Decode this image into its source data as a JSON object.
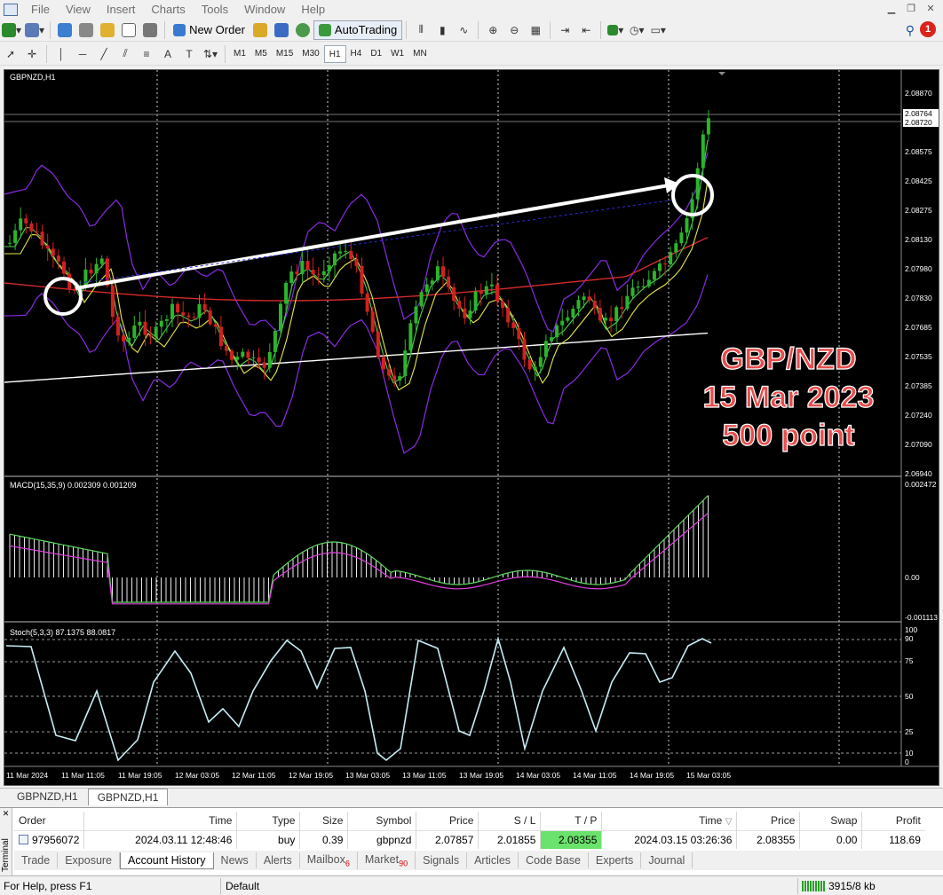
{
  "menu": [
    "File",
    "View",
    "Insert",
    "Charts",
    "Tools",
    "Window",
    "Help"
  ],
  "toolbar": {
    "new_order_label": "New Order",
    "autotrading_label": "AutoTrading",
    "notification_count": "1",
    "timeframes": [
      "M1",
      "M5",
      "M15",
      "M30",
      "H1",
      "H4",
      "D1",
      "W1",
      "MN"
    ],
    "active_timeframe": "H1"
  },
  "chart": {
    "symbol_label": "GBPNZD,H1",
    "annotation": {
      "line1": "GBP/NZD",
      "line2": "15 Mar 2023",
      "line3": "500 point",
      "color": "#e84c4c"
    },
    "price_ticks": [
      "2.08870",
      "2.08720",
      "2.08575",
      "2.08425",
      "2.08275",
      "2.08130",
      "2.07980",
      "2.07830",
      "2.07685",
      "2.07535",
      "2.07385",
      "2.07240",
      "2.07090",
      "2.06940"
    ],
    "current_prices": [
      "2.08764",
      "2.08720"
    ],
    "time_labels": [
      "11 Mar 2024",
      "11 Mar 11:05",
      "11 Mar 19:05",
      "12 Mar 03:05",
      "12 Mar 11:05",
      "12 Mar 19:05",
      "13 Mar 03:05",
      "13 Mar 11:05",
      "13 Mar 19:05",
      "14 Mar 03:05",
      "14 Mar 11:05",
      "14 Mar 19:05",
      "15 Mar 03:05"
    ],
    "macd_label": "MACD(15,35,9) 0.002309 0.001209",
    "macd_ticks": [
      "0.002472",
      "0.00",
      "-0.001113"
    ],
    "stoch_label": "Stoch(5,3,3) 87.1375 88.0817",
    "stoch_ticks": [
      "100",
      "90",
      "75",
      "50",
      "25",
      "10",
      "0"
    ],
    "colors": {
      "bull": "#2bb52b",
      "bear": "#d42020",
      "bb": "#8a2be2",
      "ma_white": "#ffffff",
      "ma_red": "#d42a2a",
      "ma_yellow": "#e8e84a",
      "ma_green": "#4fd04f",
      "stoch": "#c6ecf5"
    }
  },
  "chart_tabs": [
    "GBPNZD,H1",
    "GBPNZD,H1"
  ],
  "terminal": {
    "side_label": "Terminal",
    "columns": [
      "Order",
      "Time",
      "Type",
      "Size",
      "Symbol",
      "Price",
      "S / L",
      "T / P",
      "Time",
      "Price",
      "Swap",
      "Profit"
    ],
    "row": {
      "order": "97956072",
      "time": "2024.03.11 12:48:46",
      "type": "buy",
      "size": "0.39",
      "symbol": "gbpnzd",
      "price": "2.07857",
      "sl": "2.01855",
      "tp": "2.08355",
      "close_time": "2024.03.15 03:26:36",
      "close_price": "2.08355",
      "swap": "0.00",
      "profit": "118.69"
    },
    "tabs": [
      {
        "label": "Trade",
        "badge": ""
      },
      {
        "label": "Exposure",
        "badge": ""
      },
      {
        "label": "Account History",
        "badge": ""
      },
      {
        "label": "News",
        "badge": ""
      },
      {
        "label": "Alerts",
        "badge": ""
      },
      {
        "label": "Mailbox",
        "badge": "6"
      },
      {
        "label": "Market",
        "badge": "90"
      },
      {
        "label": "Signals",
        "badge": ""
      },
      {
        "label": "Articles",
        "badge": ""
      },
      {
        "label": "Code Base",
        "badge": ""
      },
      {
        "label": "Experts",
        "badge": ""
      },
      {
        "label": "Journal",
        "badge": ""
      }
    ],
    "active_tab": "Account History"
  },
  "status": {
    "help": "For Help, press F1",
    "profile": "Default",
    "traffic": "3915/8 kb"
  }
}
